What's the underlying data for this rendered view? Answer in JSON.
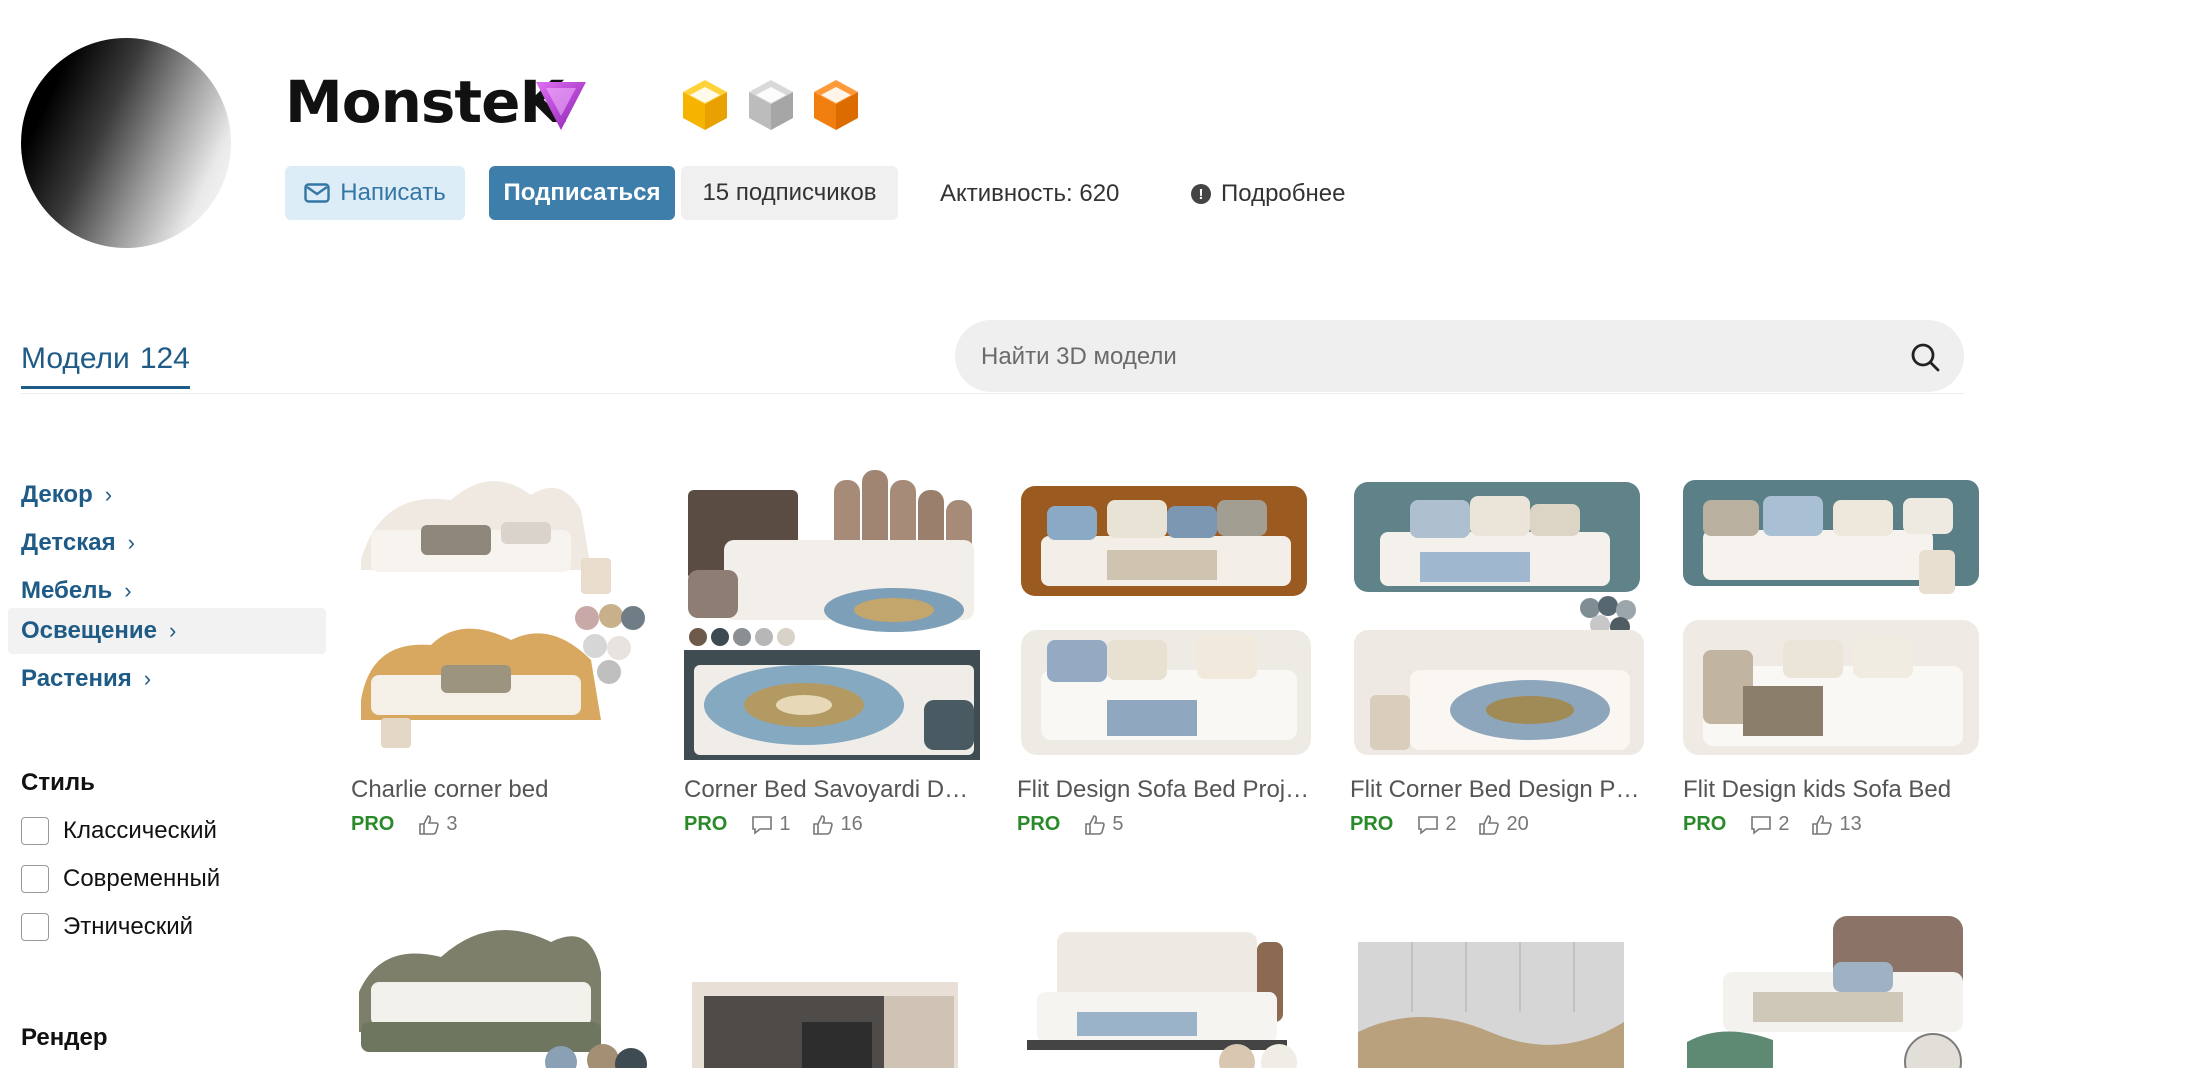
{
  "profile": {
    "username": "MonsteK",
    "write_label": "Написать",
    "subscribe_label": "Подписаться",
    "subscribers_label": "15 подписчиков",
    "activity_label": "Активность: 620",
    "more_label": "Подробнее",
    "more_icon_glyph": "!"
  },
  "tabs": {
    "models_label": "Модели",
    "models_count": "124"
  },
  "search": {
    "placeholder": "Найти 3D модели"
  },
  "sidebar": {
    "categories": [
      {
        "label": "Декор"
      },
      {
        "label": "Детская"
      },
      {
        "label": "Мебель"
      },
      {
        "label": "Освещение"
      },
      {
        "label": "Растения"
      }
    ],
    "chevron": "›",
    "style_title": "Стиль",
    "styles": [
      {
        "label": "Классический"
      },
      {
        "label": "Современный"
      },
      {
        "label": "Этнический"
      }
    ],
    "render_title": "Рендер"
  },
  "models": [
    {
      "title": "Charlie corner bed",
      "badge": "PRO",
      "comments": null,
      "likes": "3"
    },
    {
      "title": "Corner Bed Savoyardi Design Project",
      "badge": "PRO",
      "comments": "1",
      "likes": "16"
    },
    {
      "title": "Flit Design Sofa Bed Project",
      "badge": "PRO",
      "comments": null,
      "likes": "5"
    },
    {
      "title": "Flit Corner Bed Design Project",
      "badge": "PRO",
      "comments": "2",
      "likes": "20"
    },
    {
      "title": "Flit Design kids Sofa Bed",
      "badge": "PRO",
      "comments": "2",
      "likes": "13"
    }
  ],
  "colors": {
    "primary": "#3e7eab",
    "link": "#1e5b86",
    "pro_green": "#2a8a2a",
    "write_bg": "#dcedf8"
  }
}
